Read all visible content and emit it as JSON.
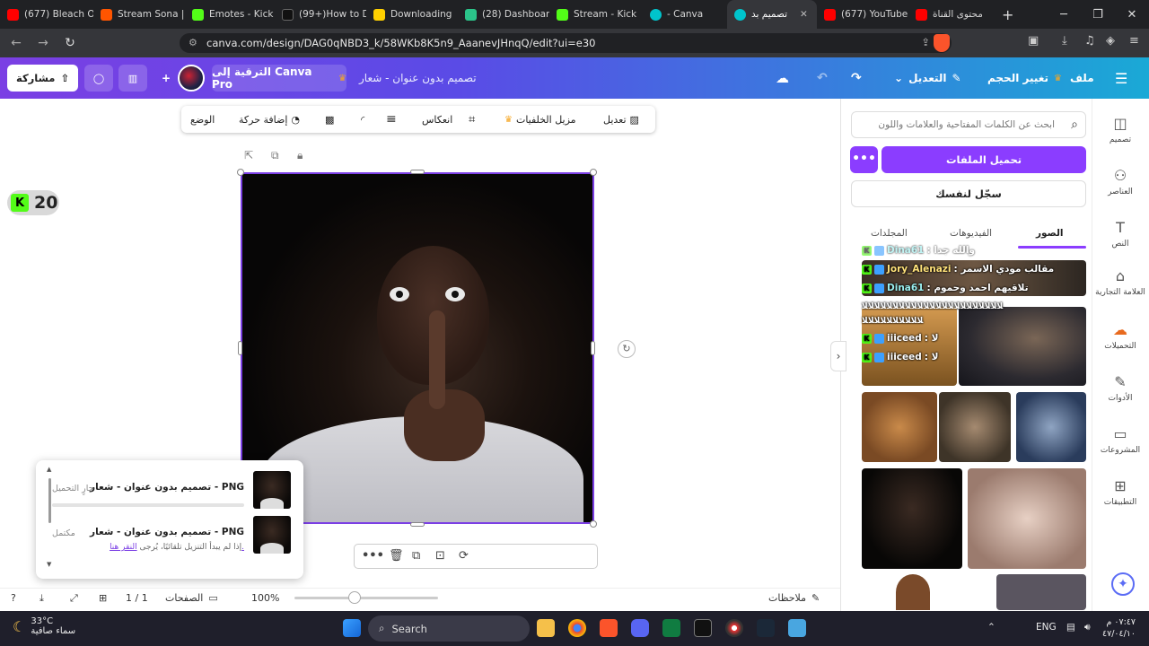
{
  "browser": {
    "tabs": [
      {
        "label": "(677) Bleach O",
        "color": "#ff0000"
      },
      {
        "label": "Stream Sona |",
        "color": "#ff5500"
      },
      {
        "label": "Emotes - Kick",
        "color": "#53fc18"
      },
      {
        "label": "(99+)How to D",
        "color": "#111111"
      },
      {
        "label": "Downloading",
        "color": "#ffd000"
      },
      {
        "label": "(28) Dashboar",
        "color": "#2bc48a"
      },
      {
        "label": "Stream - Kick",
        "color": "#53fc18"
      },
      {
        "label": "- Canva",
        "color": "#00c4cc"
      },
      {
        "label": "تصميم بد",
        "color": "#00c4cc"
      },
      {
        "label": "(677) YouTube",
        "color": "#ff0000"
      },
      {
        "label": "محتوى القناة",
        "color": "#ff0000"
      }
    ],
    "url": "canva.com/design/DAG0qNBD3_k/58WKb8K5n9_AaanevJHnqQ/edit?ui=e30",
    "brave_badge": "2"
  },
  "canva_header": {
    "share_label": "مشاركة",
    "upgrade_label": "الترقية إلى Canva Pro",
    "design_title": "تصميم بدون عنوان - شعار",
    "edit_label": "التعديل",
    "resize_label": "تغيير الحجم",
    "file_label": "ملف"
  },
  "context_toolbar": {
    "position_label": "الوضع",
    "animate_label": "إضافة حركة",
    "flip_label": "انعكاس",
    "bg_remover_label": "مزيل الخلفيات",
    "edit_label": "تعديل"
  },
  "badge": {
    "count": "20",
    "k_letter": "K"
  },
  "downloads": [
    {
      "title": "PNG - تصميم بدون عنوان - شعار",
      "status": "جارٍ التحميل"
    },
    {
      "title": "PNG - تصميم بدون عنوان - شعار",
      "status": "مكتمل",
      "note": "إذا لم يبدأ التنزيل تلقائيًا، يُرجى",
      "link": "النقر هنا."
    }
  ],
  "statusbar": {
    "notes_label": "ملاحظات",
    "zoom": "100%",
    "pages_label": "الصفحات",
    "page_count": "1 / 1"
  },
  "panel": {
    "search_placeholder": "ابحث عن الكلمات المفتاحية والعلامات واللون",
    "upload_label": "تحميل الملفات",
    "more_label": "•••",
    "record_label": "سجّل لنفسك",
    "tabs": [
      "الصور",
      "الفيديوهات",
      "المجلدات"
    ]
  },
  "chat": [
    {
      "user": "Dina61",
      "msg": ": والله جدا"
    },
    {
      "user": "Jory_Alenazi",
      "msg": ": مقالب مودي الاسمر"
    },
    {
      "user": "Dina61",
      "msg": ": تلاقيهم احمد وحموم"
    },
    {
      "user": "",
      "msg": "ﻼﻼﻼﻼﻼﻼﻼﻼﻼﻼﻼﻼﻼﻼﻼﻼﻼﻼﻼﻼﻼﻼﻼ"
    },
    {
      "user": "",
      "msg": "ﻼﻼﻼﻼﻼﻼﻼﻼﻼﻼ"
    },
    {
      "user": "iiiceed",
      "msg": ": لا"
    },
    {
      "user": "iiiceed",
      "msg": ": لا"
    }
  ],
  "rail": [
    {
      "label": "تصميم",
      "icon": "design-icon"
    },
    {
      "label": "العناصر",
      "icon": "elements-icon"
    },
    {
      "label": "النص",
      "icon": "text-icon"
    },
    {
      "label": "العلامة التجارية",
      "icon": "brand-icon"
    },
    {
      "label": "التحميلات",
      "icon": "uploads-icon"
    },
    {
      "label": "الأدوات",
      "icon": "tools-icon"
    },
    {
      "label": "المشروعات",
      "icon": "projects-icon"
    },
    {
      "label": "التطبيقات",
      "icon": "apps-icon"
    }
  ],
  "taskbar": {
    "temperature": "33°C",
    "weather": "سماء صافية",
    "search_label": "Search",
    "language": "ENG",
    "time": "٠٧:٤٧ م",
    "date": "٤٧/٠٤/١٠"
  }
}
